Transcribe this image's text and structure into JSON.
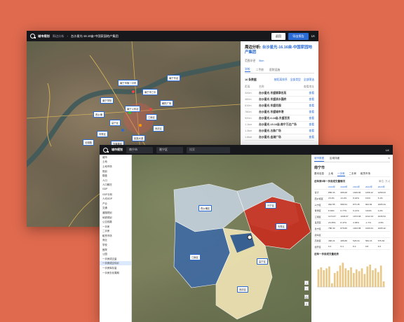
{
  "win1": {
    "brand": "城市规划",
    "crumb": "周边分析",
    "crumb_title": "台沙星光-16.16亩-中国家园地产集团",
    "btn_secondary": "返回",
    "btn_primary": "导出报告",
    "user": "LK",
    "markers": [
      "南宁市第一中学",
      "南宁市三中",
      "南宁学校",
      "南宁火车站",
      "西乡塘",
      "江南区",
      "邕宁区",
      "良庆区",
      "青秀区",
      "民族大道",
      "五象新区",
      "南宁东站",
      "北湖路",
      "朝阳广场"
    ],
    "panel": {
      "title_prefix": "周边分析:",
      "title_link": "台沙星光-16.16亩-中国家园地产集团",
      "range_label": "范围半径",
      "range_value": "5km",
      "tabs": [
        "学校",
        "二手房",
        "医院设施"
      ],
      "count_label": "16 条数据",
      "sort_a": "按距离排序",
      "sort_b": "全部类型",
      "sort_c": "全部筛选",
      "col_dist": "距离",
      "col_name": "名称",
      "col_op": "查看地址",
      "rows": [
        {
          "dist": "320m",
          "name": "台沙星光-东盟翡翠名苑",
          "op": "查看"
        },
        {
          "dist": "460m",
          "name": "台沙星光-东盟滨水国府",
          "op": "查看"
        },
        {
          "dist": "610m",
          "name": "台沙星光-东盟花园",
          "op": "查看"
        },
        {
          "dist": "780m",
          "name": "台沙星光-东盟城市港",
          "op": "查看"
        },
        {
          "dist": "920m",
          "name": "台沙星光-6.18亩-东盟百货",
          "op": "查看"
        },
        {
          "dist": "1.1km",
          "name": "台沙星光-15.16亩-南宁万达广场",
          "op": "查看"
        },
        {
          "dist": "1.3km",
          "name": "台沙星光-五象广场",
          "op": "查看"
        },
        {
          "dist": "1.6km",
          "name": "台沙星光-金湖广场",
          "op": "查看"
        }
      ]
    }
  },
  "win2": {
    "brand": "城市规划",
    "select1": "南宁市",
    "select2": "邕宁区",
    "search_placeholder": "搜索",
    "user": "LK",
    "sidebar": [
      "城市",
      "土地",
      "土地市场",
      "规划",
      "楼盘",
      "人口",
      "人口概况",
      "GDP",
      "GDP分析",
      "人均GDP",
      "产业",
      "交通",
      "道路规划",
      "地铁规划",
      "公交线路",
      "一手房",
      "二手房",
      "租赁市场",
      "商业",
      "学校",
      "医院",
      "公园",
      "一手房成交量",
      "一手房成交均价",
      "一手房库存量",
      "一手房去化周期"
    ],
    "selected_sidebar": "一手房成交均价",
    "districts": [
      "西乡塘区",
      "兴宁区",
      "青秀区",
      "江南区",
      "良庆区",
      "邕宁区"
    ],
    "right": {
      "tabs": [
        "城市数据",
        "区域详细"
      ],
      "city": "南宁市",
      "subtabs": [
        "基本信息",
        "土地",
        "一手房",
        "二手房",
        "租赁市场"
      ],
      "table_title": "近年来5年一手房成交量情况",
      "unit": "单位: 万㎡",
      "years": [
        "2019年",
        "2020年",
        "2021年",
        "2022年",
        "2023年"
      ],
      "rows": [
        {
          "name": "合计",
          "vals": [
            "858.33",
            "985.68",
            "1029.84",
            "1158.12",
            "1259.03"
          ]
        },
        {
          "name": "西乡塘区",
          "vals": [
            "15.3%",
            "14.2%",
            "8.22%",
            "0.9%",
            "5.1%"
          ]
        },
        {
          "name": "兴宁区",
          "vals": [
            "962.55",
            "586.54",
            "873.35",
            "843.84",
            "1065.34"
          ]
        },
        {
          "name": "青秀区",
          "vals": [
            "8.39%",
            "6.77%",
            "6.21%",
            "3.84%",
            "4.2%"
          ]
        },
        {
          "name": "江南区",
          "vals": [
            "1174.67",
            "1046.07",
            "1073.68",
            "1012.34",
            "1036.54"
          ]
        },
        {
          "name": "良庆区",
          "vals": [
            "23.35%",
            "8.47%",
            "4.38%",
            "-1.7%",
            "-0.5%"
          ]
        },
        {
          "name": "邕宁区",
          "vals": [
            "788.30",
            "876.86",
            "1043.88",
            "1026.61",
            "1065.42"
          ]
        },
        {
          "name": "武鸣区",
          "vals": [
            "",
            "",
            "",
            "",
            ""
          ]
        },
        {
          "name": "高新区",
          "vals": [
            "468.24",
            "486.88",
            "526.64",
            "584.15",
            "675.84"
          ]
        },
        {
          "name": "经开区",
          "vals": [
            "9.4",
            "9.4",
            "8.4",
            "9.8",
            "9.4"
          ]
        }
      ],
      "chart_title": "近年一手房成交量走势"
    }
  },
  "chart_data": {
    "type": "bar",
    "title": "近年一手房成交量走势",
    "categories": [
      "1",
      "2",
      "3",
      "4",
      "5",
      "6",
      "7",
      "8",
      "9",
      "10",
      "11",
      "12",
      "13",
      "14",
      "15",
      "16",
      "17",
      "18",
      "19",
      "20",
      "21",
      "22",
      "23",
      "24",
      "25"
    ],
    "values": [
      38,
      42,
      36,
      40,
      44,
      8,
      30,
      34,
      46,
      52,
      40,
      36,
      42,
      30,
      38,
      34,
      40,
      28,
      44,
      48,
      36,
      40,
      32,
      46,
      12
    ],
    "ylim": [
      0,
      60
    ]
  },
  "colors": {
    "accent": "#2b6bd6",
    "bar": "#e9c98a",
    "d1": "#c9d7e6",
    "d2": "#2e5a8f",
    "d3": "#c62f1f",
    "d4": "#3f6aa3",
    "d5": "#f2e6b5",
    "d6": "#6e8fb7"
  }
}
